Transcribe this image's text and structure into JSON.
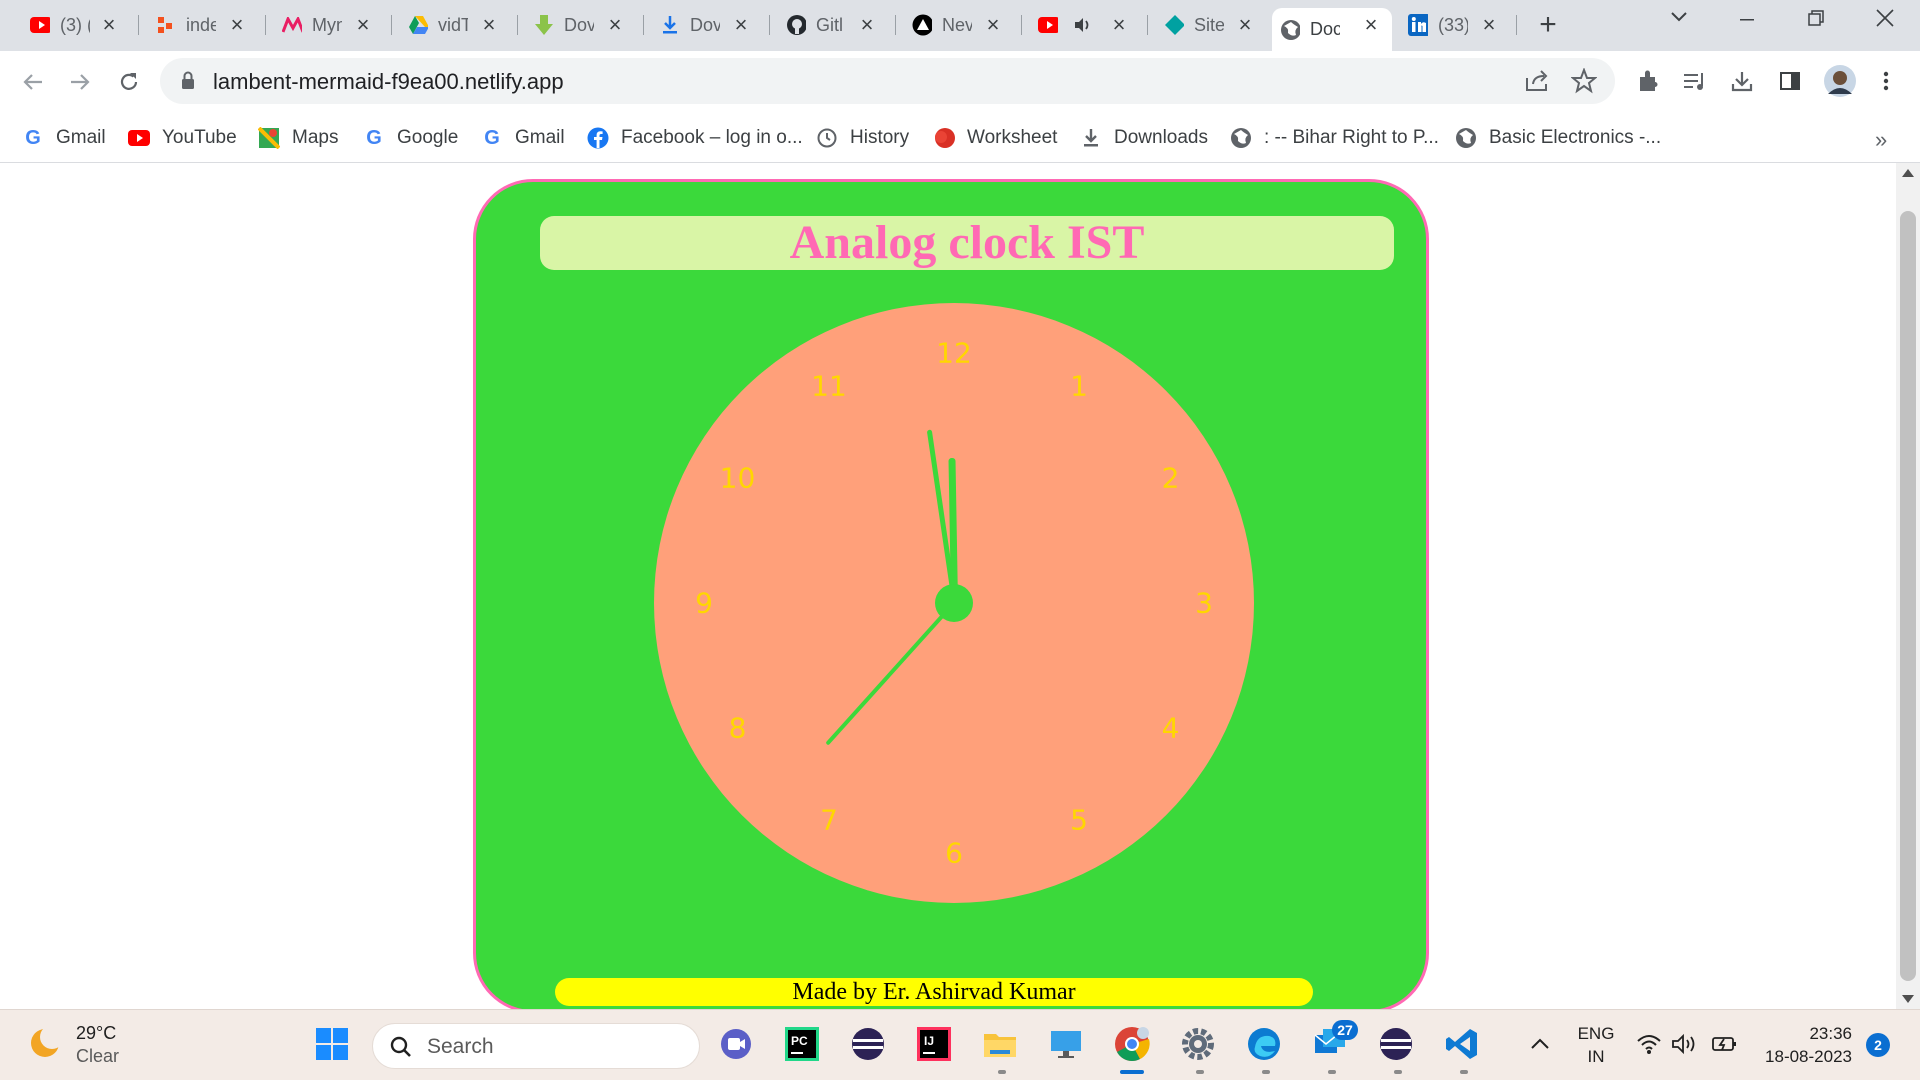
{
  "browser": {
    "tabs": [
      {
        "title": "(3) (",
        "icon": "youtube-icon"
      },
      {
        "title": "inde",
        "icon": "code-icon"
      },
      {
        "title": "Myn",
        "icon": "myntra-icon"
      },
      {
        "title": "vidT",
        "icon": "google-drive-icon"
      },
      {
        "title": "Dov",
        "icon": "download-green-icon"
      },
      {
        "title": "Dov",
        "icon": "download-blue-icon"
      },
      {
        "title": "Gitl",
        "icon": "github-icon"
      },
      {
        "title": "Nev",
        "icon": "triangle-icon"
      },
      {
        "title": "",
        "icon": "youtube-audio-icon"
      },
      {
        "title": "Site",
        "icon": "diamond-icon"
      },
      {
        "title": "Doc",
        "icon": "globe-icon"
      },
      {
        "title": "(33)",
        "icon": "linkedin-icon"
      }
    ],
    "active_tab_index": 10,
    "address": "lambent-mermaid-f9ea00.netlify.app",
    "bookmarks": [
      {
        "label": "Gmail",
        "icon": "google-icon"
      },
      {
        "label": "YouTube",
        "icon": "youtube-icon"
      },
      {
        "label": "Maps",
        "icon": "maps-icon"
      },
      {
        "label": "Google",
        "icon": "google-icon"
      },
      {
        "label": "Gmail",
        "icon": "google-icon"
      },
      {
        "label": "Facebook – log in o...",
        "icon": "facebook-icon"
      },
      {
        "label": "History",
        "icon": "history-icon"
      },
      {
        "label": "Worksheet",
        "icon": "worksheet-icon"
      },
      {
        "label": "Downloads",
        "icon": "download-icon"
      },
      {
        "label": ": -- Bihar Right to P...",
        "icon": "globe-icon"
      },
      {
        "label": "Basic Electronics -...",
        "icon": "globe-icon"
      }
    ]
  },
  "page": {
    "title": "Analog clock IST",
    "footer": "Made by Er. Ashirvad Kumar",
    "clock_numbers": [
      "12",
      "1",
      "2",
      "3",
      "4",
      "5",
      "6",
      "7",
      "8",
      "9",
      "10",
      "11"
    ],
    "time": {
      "hour": 11,
      "minute": 58,
      "second": 37
    },
    "colors": {
      "card": "#3bd93b",
      "border": "#ff69b4",
      "face": "#ffa07a",
      "numbers": "#ffd700",
      "title_bg": "#d9f5a6",
      "title_text": "#ff69b4",
      "footer_bg": "#ffff00"
    }
  },
  "taskbar": {
    "weather": {
      "temp": "29°C",
      "condition": "Clear"
    },
    "search_placeholder": "Search",
    "mail_badge": "27",
    "language": {
      "lang": "ENG",
      "region": "IN"
    },
    "clock": {
      "time": "23:36",
      "date": "18-08-2023"
    },
    "notification_count": "2"
  }
}
